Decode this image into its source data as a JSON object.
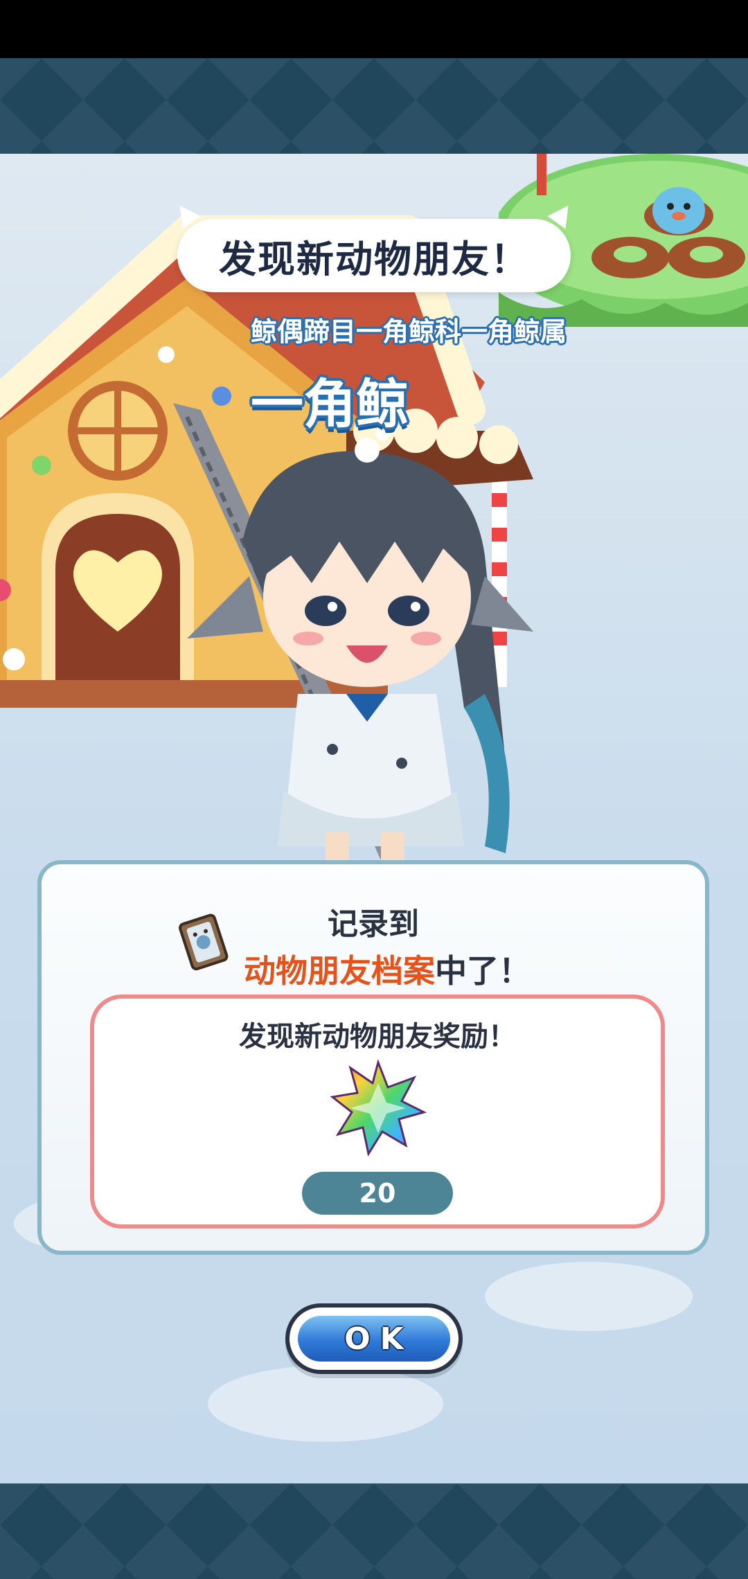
{
  "dialog": {
    "title": "发现新动物朋友！",
    "taxonomy": "鲸偶蹄目一角鲸科一角鲸属",
    "animal_name": "一角鲸"
  },
  "record": {
    "line1": "记录到",
    "highlight": "动物朋友档案",
    "line2_suffix": "中了！",
    "icon": "notebook-icon"
  },
  "reward": {
    "title": "发现新动物朋友奖励！",
    "item_icon": "rainbow-gem-icon",
    "count": "20"
  },
  "ok_button": {
    "label": "OK"
  },
  "colors": {
    "highlight": "#e5531a",
    "reward_border": "#f08a8a",
    "card_border": "#87b7c9",
    "ok_blue": "#2f7ad8"
  }
}
